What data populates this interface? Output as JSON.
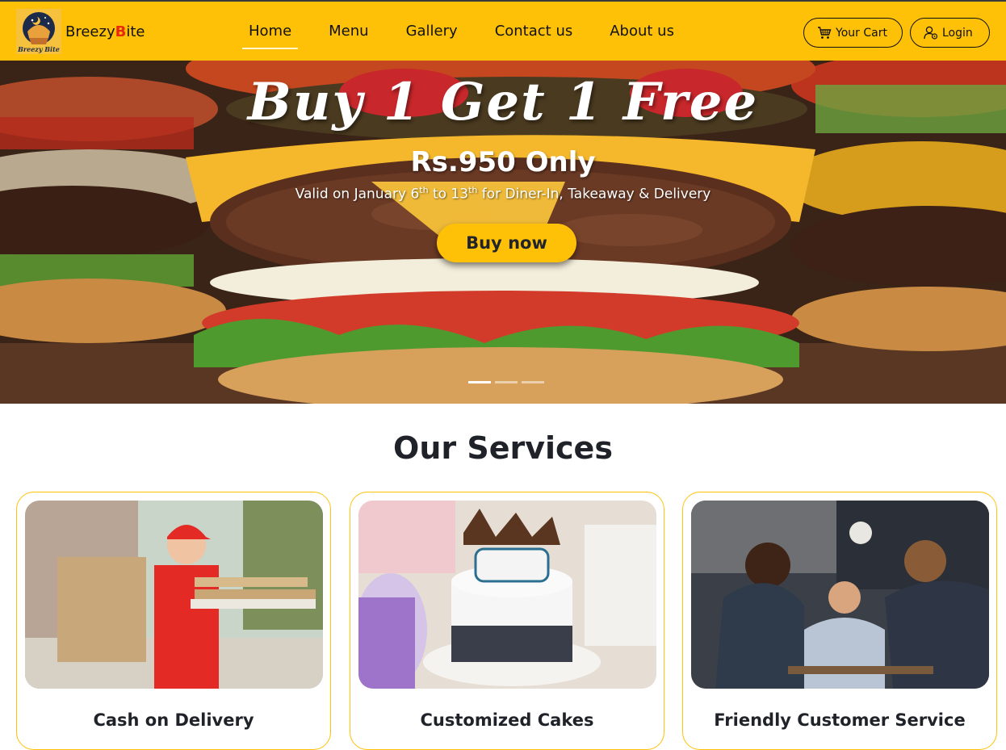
{
  "brand": {
    "name_prefix": "Breezy",
    "name_accent": "B",
    "name_suffix": "ite",
    "logo_text": "Breezy Bite"
  },
  "nav": {
    "links": [
      {
        "label": "Home",
        "active": true
      },
      {
        "label": "Menu"
      },
      {
        "label": "Gallery"
      },
      {
        "label": "Contact us"
      },
      {
        "label": "About us"
      }
    ],
    "cart_label": "Your Cart",
    "login_label": "Login"
  },
  "hero": {
    "title": "Buy 1 Get 1 Free",
    "price": "Rs.950 Only",
    "valid_prefix": "Valid on January 6",
    "valid_sup1": "th",
    "valid_mid": " to 13",
    "valid_sup2": "th",
    "valid_suffix": " for Diner-In, Takeaway & Delivery",
    "cta_label": "Buy now",
    "slide_count": 3,
    "active_slide": 1
  },
  "services": {
    "title": "Our Services",
    "cards": [
      {
        "title": "Cash on Delivery"
      },
      {
        "title": "Customized Cakes"
      },
      {
        "title": "Friendly Customer Service"
      }
    ]
  },
  "colors": {
    "primary": "#ffc107",
    "brand_accent": "#e8290b",
    "text_dark": "#1f2329"
  }
}
